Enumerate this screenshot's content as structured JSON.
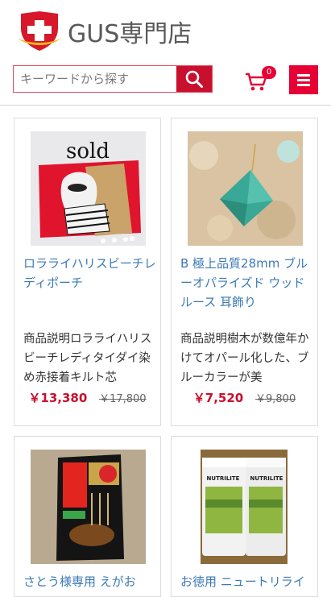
{
  "brand": {
    "name": "GUS専門店"
  },
  "search": {
    "placeholder": "キーワードから探す"
  },
  "cart": {
    "count": "0"
  },
  "products": [
    {
      "photo_text": "sold",
      "title": "ロラライハリスビーチレディポーチ",
      "description": "商品説明ロラライハリスビーチレディタイダイ染め赤接着キルト芯",
      "price": "￥13,380",
      "old_price": "￥17,800"
    },
    {
      "title": "B 極上品質28mm ブルーオパライズド ウッドルース 耳飾り",
      "description": "商品説明樹木が数億年かけてオパール化した、ブルーカラーが美",
      "price": "￥7,520",
      "old_price": "￥9,800"
    },
    {
      "title": "さとう様専用 えがお",
      "description": "",
      "price": "",
      "old_price": ""
    },
    {
      "photo_text": "NUTRILITE",
      "title": "お徳用 ニュートリライ",
      "description": "",
      "price": "",
      "old_price": ""
    }
  ]
}
